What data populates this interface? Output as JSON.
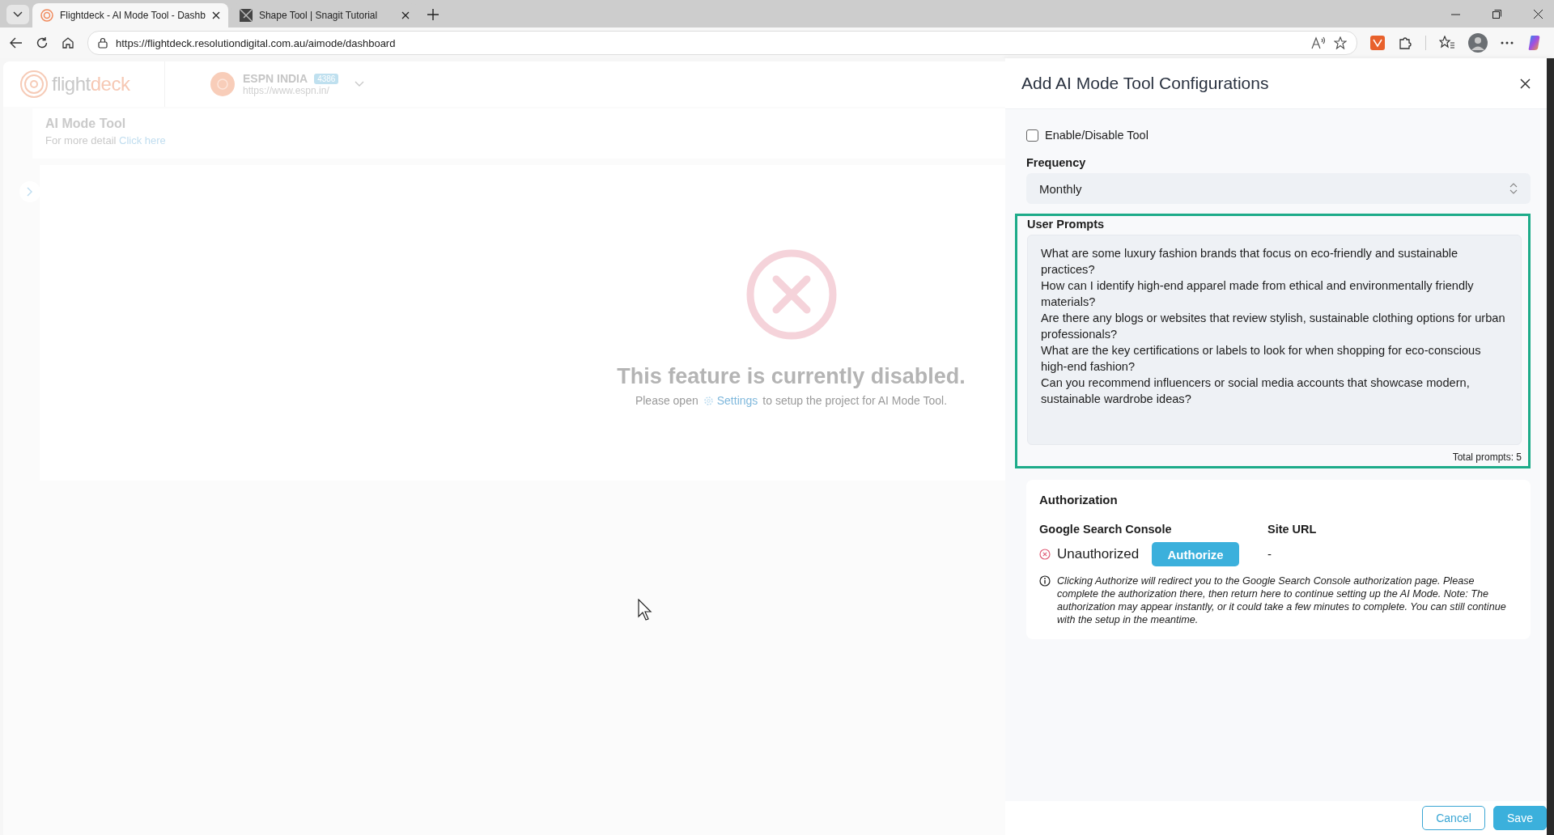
{
  "browser": {
    "tabs": [
      {
        "title": "Flightdeck - AI Mode Tool - Dashb",
        "selected": true
      },
      {
        "title": "Shape Tool | Snagit Tutorial",
        "selected": false
      }
    ],
    "url": "https://flightdeck.resolutiondigital.com.au/aimode/dashboard"
  },
  "app": {
    "logo_parts": [
      "flight",
      "deck"
    ],
    "project": {
      "name": "ESPN INDIA",
      "badge": "4386",
      "url": "https://www.espn.in/"
    },
    "page": {
      "title": "AI Mode Tool",
      "detail_text": "For more detail",
      "detail_link": "Click here"
    },
    "disabled_notice": {
      "heading": "This feature is currently disabled.",
      "text_before": "Please open",
      "link": "Settings",
      "text_after": "to setup the project for AI Mode Tool."
    }
  },
  "panel": {
    "title": "Add AI Mode Tool Configurations",
    "enable_tool": {
      "label": "Enable/Disable Tool",
      "checked": false
    },
    "frequency": {
      "label": "Frequency",
      "value": "Monthly"
    },
    "user_prompts": {
      "label": "User Prompts",
      "highlighted": true,
      "total": "Total prompts: 5",
      "prompts": [
        "What are some luxury fashion brands that focus on eco-friendly and sustainable practices?",
        "How can I identify high-end apparel made from ethical and environmentally friendly materials?",
        "Are there any blogs or websites that review stylish, sustainable clothing options for urban professionals?",
        "What are the key certifications or labels to look for when shopping for eco-conscious high-end fashion?",
        "Can you recommend influencers or social media accounts that showcase modern, sustainable wardrobe ideas?"
      ]
    },
    "authorization": {
      "title": "Authorization",
      "gsc_label": "Google Search Console",
      "status": "Unauthorized",
      "authorized": false,
      "authorize_button": "Authorize",
      "site_url_label": "Site URL",
      "site_url_value": "-",
      "note": "Clicking Authorize will redirect you to the Google Search Console authorization page. Please complete the authorization there, then return here to continue setting up the AI Mode. Note: The authorization may appear instantly, or it could take a few minutes to complete. You can still continue with the setup in the meantime."
    },
    "buttons": [
      {
        "label": "Cancel",
        "kind": "secondary"
      },
      {
        "label": "Save",
        "kind": "primary"
      }
    ]
  }
}
